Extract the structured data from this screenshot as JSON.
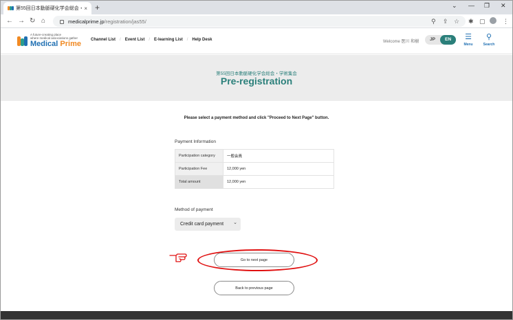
{
  "browser": {
    "tab_title": "第55回日本動脈硬化学会総会・学...",
    "tab_close": "×",
    "new_tab": "+",
    "url_host": "medicalprime.jp",
    "url_path": "/registration/jas55/",
    "nav": {
      "back": "←",
      "forward": "→",
      "reload": "↻",
      "home": "⌂"
    },
    "window": {
      "chevron": "⌄",
      "minimize": "—",
      "restore": "❐",
      "close": "✕"
    },
    "toolbar": {
      "zoom": "⚲",
      "share": "⇪",
      "bookmark": "☆",
      "extensions": "✱",
      "sidepanel": "▢",
      "menu": "⋮"
    }
  },
  "site": {
    "logo_tagline_1": "A future-creating place",
    "logo_tagline_2": "where medical associations gather",
    "logo_name_1": "Medical",
    "logo_name_2": "Prime",
    "nav_links": [
      "Channel List",
      "Event List",
      "E-learning List",
      "Help Desk"
    ],
    "nav_separator": "/",
    "welcome": "Welcome 医川 和樹",
    "lang_jp": "JP",
    "lang_en": "EN",
    "menu_label": "Menu",
    "search_label": "Search",
    "menu_glyph": "☰",
    "search_glyph": "⚲",
    "brand_color": "#2a7f7a"
  },
  "banner": {
    "subtitle": "第55回日本動脈硬化学会総会・学術集会",
    "title": "Pre-registration"
  },
  "main": {
    "instruction": "Please select a payment method and click \"Proceed to Next Page\" button.",
    "payment_info_title": "Payment Information",
    "rows": [
      {
        "label": "Participation category",
        "value": "一般会員"
      },
      {
        "label": "Participation Fee",
        "value": "12,000 yen"
      },
      {
        "label": "Total amount",
        "value": "12,000 yen"
      }
    ],
    "method_title": "Method of payment",
    "method_selected": "Credit card payment",
    "method_chevron": "⌄",
    "next_button": "Go to next page",
    "back_button": "Back to previous page",
    "annotation_color": "#e01010"
  }
}
